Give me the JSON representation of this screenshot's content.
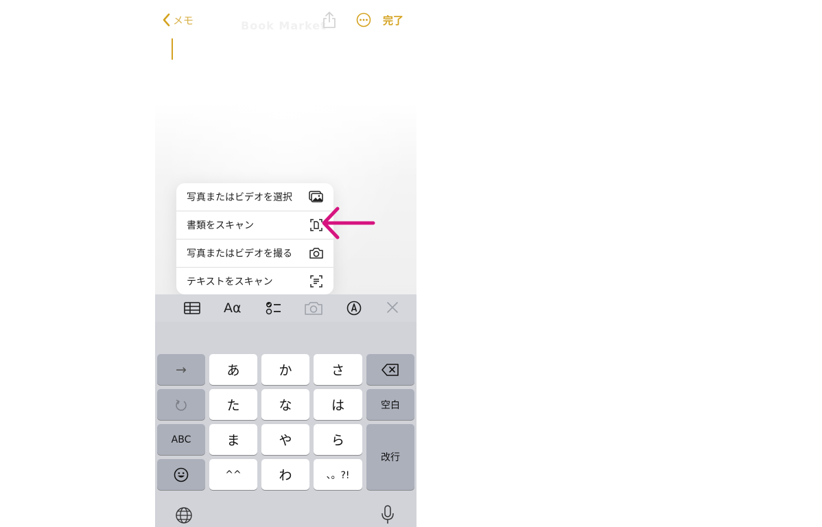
{
  "nav": {
    "back_label": "メモ",
    "done_label": "完了",
    "ghost_title": "Book Market"
  },
  "menu": {
    "items": [
      {
        "label": "写真またはビデオを選択",
        "icon": "photo-library-icon"
      },
      {
        "label": "書類をスキャン",
        "icon": "doc-scan-icon"
      },
      {
        "label": "写真またはビデオを撮る",
        "icon": "camera-icon"
      },
      {
        "label": "テキストをスキャン",
        "icon": "text-scan-icon"
      }
    ]
  },
  "toolbar": {
    "format_label": "Aα",
    "icons": [
      "table-icon",
      "format-icon",
      "checklist-icon",
      "camera-icon",
      "markup-icon",
      "close-icon"
    ]
  },
  "keyboard": {
    "rows": [
      [
        "→",
        "あ",
        "か",
        "さ",
        "⌫"
      ],
      [
        "↺",
        "た",
        "な",
        "は",
        "空白"
      ],
      [
        "ABC",
        "ま",
        "や",
        "ら",
        "改行"
      ],
      [
        "☺",
        "^^",
        "わ",
        "、。?!"
      ]
    ],
    "next_label": "→",
    "a_label": "あ",
    "ka_label": "か",
    "sa_label": "さ",
    "ta_label": "た",
    "na_label": "な",
    "ha_label": "は",
    "space_label": "空白",
    "abc_label": "ABC",
    "ma_label": "ま",
    "ya_label": "や",
    "ra_label": "ら",
    "return_label": "改行",
    "kaomoji_label": "^^",
    "wa_label": "わ",
    "punct_label": "、。?!"
  },
  "colors": {
    "accent": "#d4a21f",
    "arrow": "#d6137f",
    "keyboard_bg": "#d1d3d9",
    "dark_key": "#acb0bb"
  }
}
